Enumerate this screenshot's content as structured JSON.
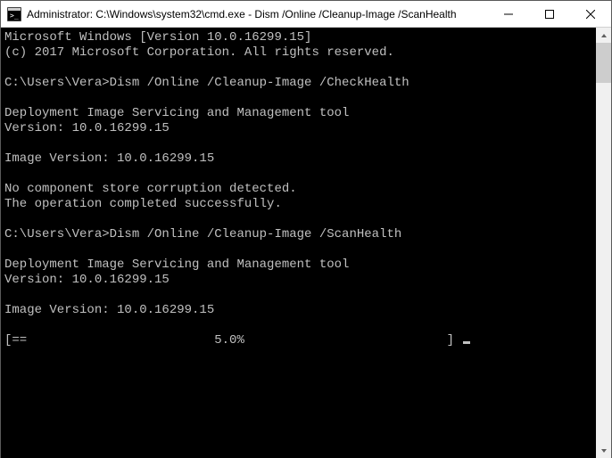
{
  "titlebar": {
    "text": "Administrator: C:\\Windows\\system32\\cmd.exe - Dism  /Online /Cleanup-Image /ScanHealth"
  },
  "terminal": {
    "lines": [
      "Microsoft Windows [Version 10.0.16299.15]",
      "(c) 2017 Microsoft Corporation. All rights reserved.",
      "",
      "C:\\Users\\Vera>Dism /Online /Cleanup-Image /CheckHealth",
      "",
      "Deployment Image Servicing and Management tool",
      "Version: 10.0.16299.15",
      "",
      "Image Version: 10.0.16299.15",
      "",
      "No component store corruption detected.",
      "The operation completed successfully.",
      "",
      "C:\\Users\\Vera>Dism /Online /Cleanup-Image /ScanHealth",
      "",
      "Deployment Image Servicing and Management tool",
      "Version: 10.0.16299.15",
      "",
      "Image Version: 10.0.16299.15",
      ""
    ],
    "progress_line": "[==                         5.0%                           ] "
  }
}
